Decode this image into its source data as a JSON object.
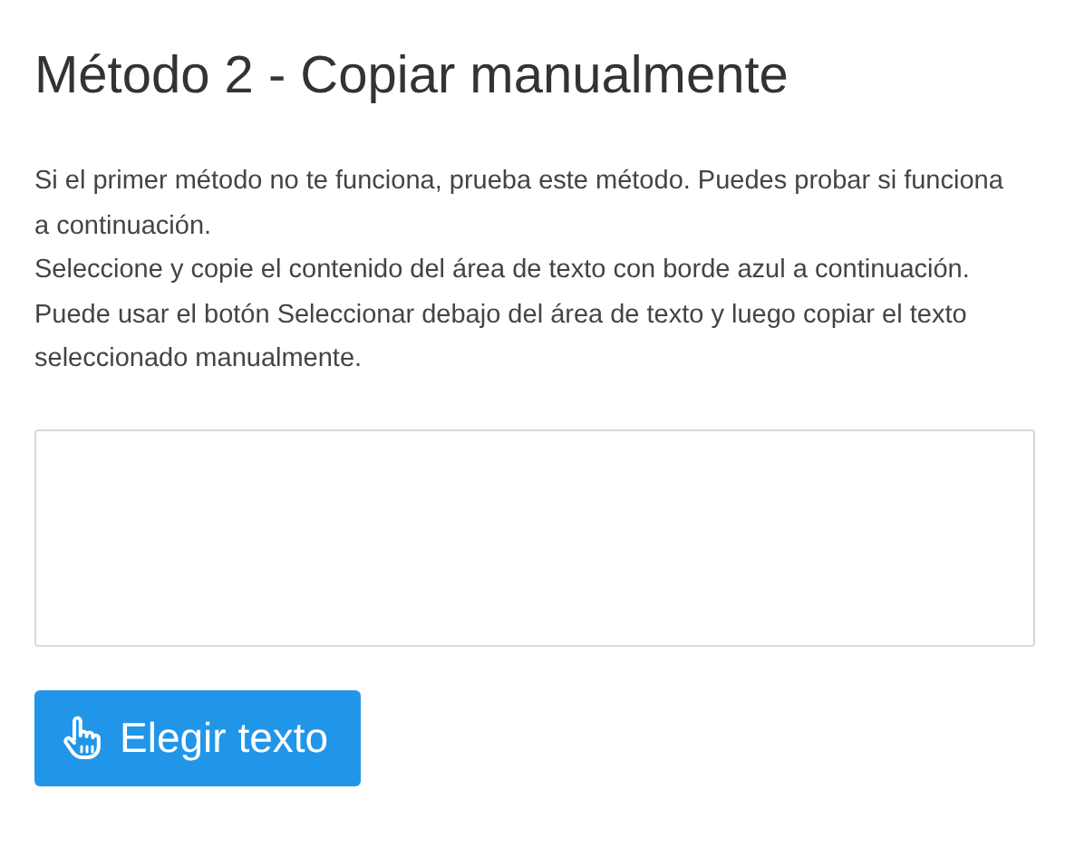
{
  "title": "Método 2 - Copiar manualmente",
  "paragraphs": [
    "Si el primer método no te funciona, prueba este método. Puedes probar si funciona a continuación.",
    "Seleccione y copie el contenido del área de texto con borde azul a continuación.",
    "Puede usar el botón Seleccionar debajo del área de texto y luego copiar el texto seleccionado manualmente."
  ],
  "button": {
    "label": "Elegir texto"
  }
}
